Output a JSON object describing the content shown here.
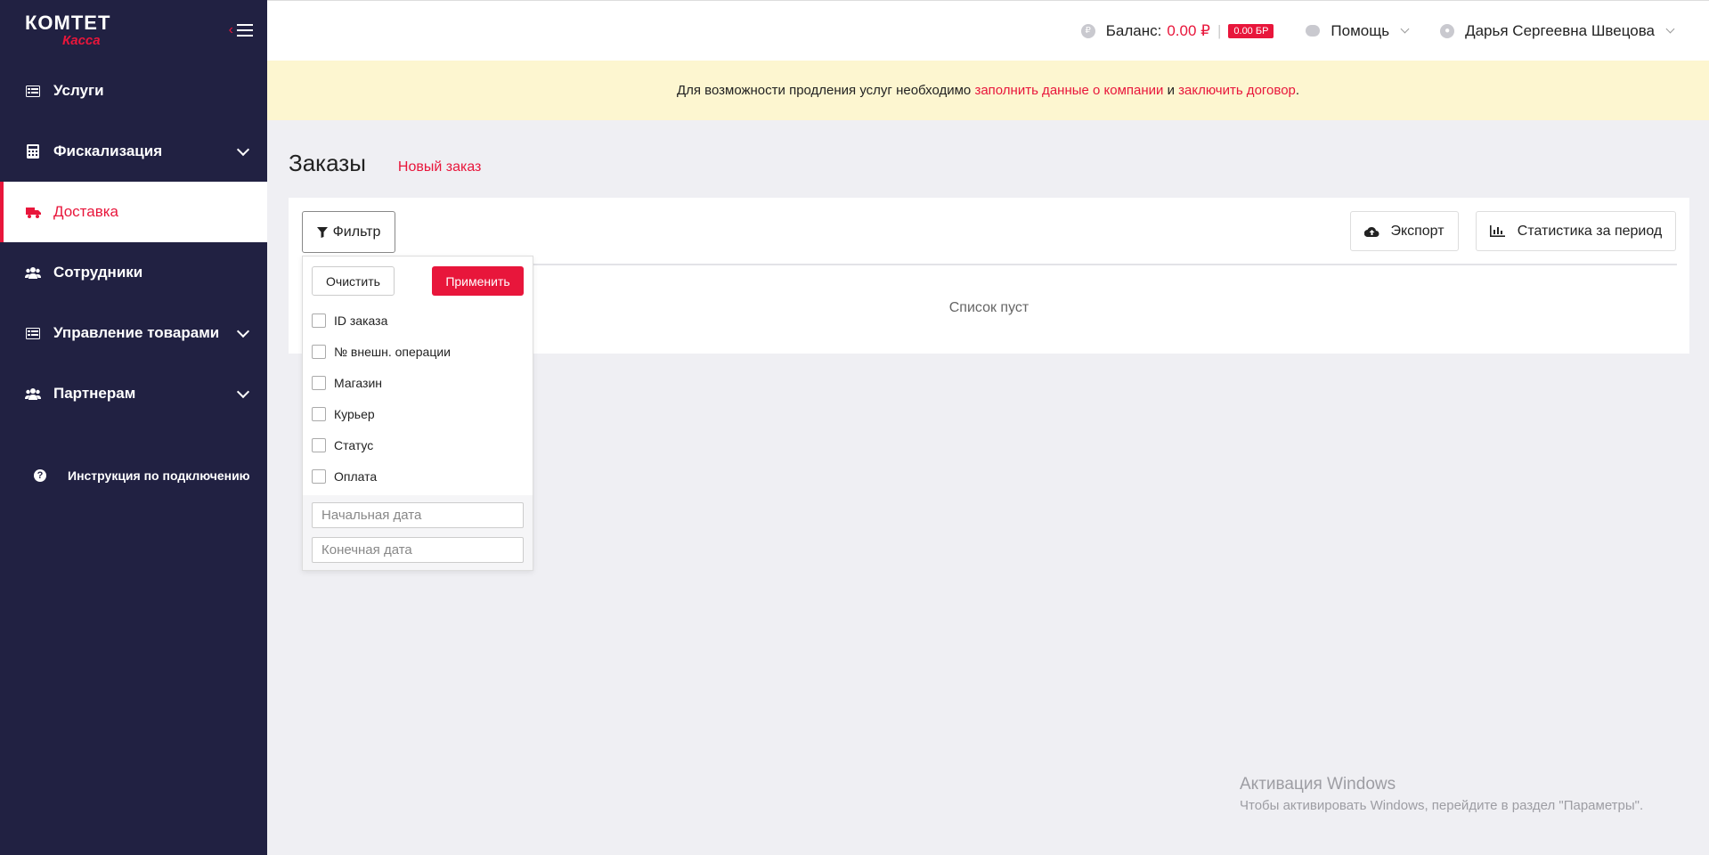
{
  "brand": {
    "logo_top": "КОМТЕТ",
    "logo_bottom": "Касса"
  },
  "sidebar": {
    "items": [
      {
        "label": "Услуги"
      },
      {
        "label": "Фискализация"
      },
      {
        "label": "Доставка"
      },
      {
        "label": "Сотрудники"
      },
      {
        "label": "Управление товарами"
      },
      {
        "label": "Партнерам"
      }
    ],
    "help_link": "Инструкция по подключению"
  },
  "topbar": {
    "balance_label": "Баланс:",
    "balance_value": "0.00 ₽",
    "balance_badge": "0.00 БР",
    "help_label": "Помощь",
    "user_name": "Дарья Сергеевна Швецова"
  },
  "notice": {
    "text_before": "Для возможности продления услуг необходимо ",
    "link1": "заполнить данные о компании",
    "text_mid": " и ",
    "link2": "заключить договор",
    "text_after": "."
  },
  "page": {
    "title": "Заказы",
    "new_order": "Новый заказ",
    "filter_label": "Фильтр",
    "export_label": "Экспорт",
    "stats_label": "Статистика за период",
    "empty_text": "Список пуст"
  },
  "filter_dropdown": {
    "clear_label": "Очистить",
    "apply_label": "Применить",
    "options": [
      {
        "label": "ID заказа"
      },
      {
        "label": "№ внешн. операции"
      },
      {
        "label": "Магазин"
      },
      {
        "label": "Курьер"
      },
      {
        "label": "Статус"
      },
      {
        "label": "Оплата"
      }
    ],
    "start_date_placeholder": "Начальная дата",
    "end_date_placeholder": "Конечная дата"
  },
  "watermark": {
    "line1": "Активация Windows",
    "line2": "Чтобы активировать Windows, перейдите в раздел \"Параметры\"."
  },
  "colors": {
    "accent": "#e8163b",
    "sidebar_bg": "#212142",
    "notice_bg": "#fdf6d0"
  }
}
